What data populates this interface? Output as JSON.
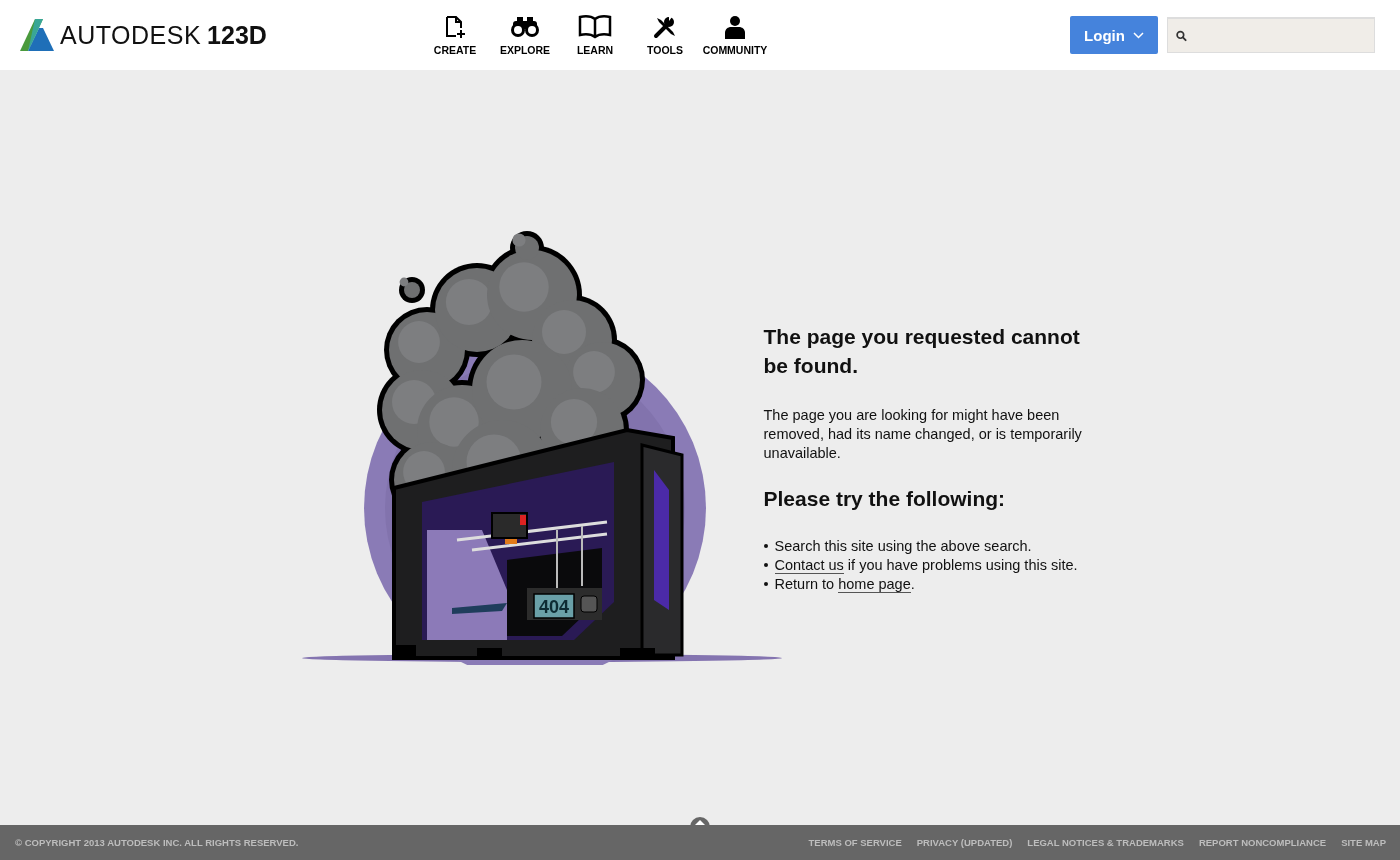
{
  "header": {
    "logo": {
      "brand": "AUTODESK",
      "product": "123D"
    },
    "nav": [
      {
        "label": "CREATE",
        "kind": "create"
      },
      {
        "label": "EXPLORE",
        "kind": "explore"
      },
      {
        "label": "LEARN",
        "kind": "learn"
      },
      {
        "label": "TOOLS",
        "kind": "tools"
      },
      {
        "label": "COMMUNITY",
        "kind": "community"
      }
    ],
    "login": "Login"
  },
  "illustration": {
    "display": "404"
  },
  "message": {
    "title": "The page you requested cannot be found.",
    "body": "The page you are looking for might have been removed, had its name changed, or is temporarily unavailable.",
    "subtitle": "Please try the following:",
    "items": [
      {
        "before": "Search this site using the above search."
      },
      {
        "link": "Contact us",
        "after": " if you have problems using this site."
      },
      {
        "before": "Return to ",
        "link": "home page",
        "after": "."
      }
    ]
  },
  "footer": {
    "copyright": "© COPYRIGHT 2013 AUTODESK INC. ALL RIGHTS RESERVED.",
    "links": [
      "TERMS OF SERVICE",
      "PRIVACY (UPDATED)",
      "LEGAL NOTICES & TRADEMARKS",
      "REPORT NONCOMPLIANCE",
      "SITE MAP"
    ]
  }
}
